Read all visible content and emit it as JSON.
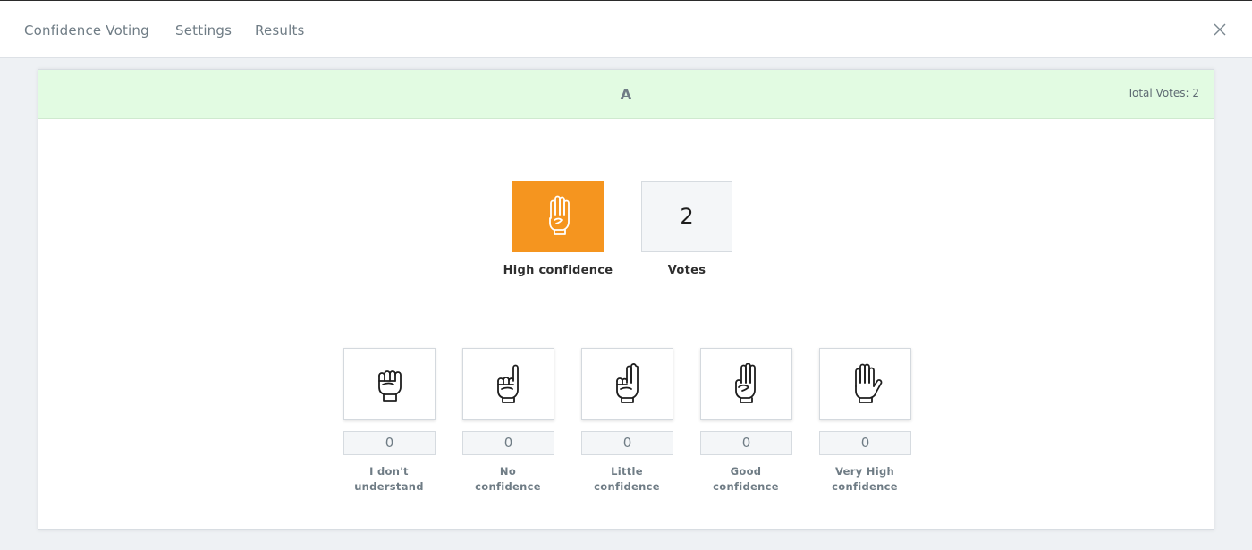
{
  "tabs": [
    {
      "label": "Confidence Voting"
    },
    {
      "label": "Settings"
    },
    {
      "label": "Results"
    }
  ],
  "card": {
    "title": "A",
    "total_votes_label": "Total Votes: 2"
  },
  "summary": {
    "result_label": "High confidence",
    "result_icon": "hand-four-fingers-icon",
    "votes_value": "2",
    "votes_label": "Votes"
  },
  "options": [
    {
      "icon": "fist-icon",
      "count": "0",
      "label_line1": "I don't",
      "label_line2": "understand"
    },
    {
      "icon": "hand-one-finger-icon",
      "count": "0",
      "label_line1": "No",
      "label_line2": "confidence"
    },
    {
      "icon": "hand-two-fingers-icon",
      "count": "0",
      "label_line1": "Little",
      "label_line2": "confidence"
    },
    {
      "icon": "hand-three-fingers-icon",
      "count": "0",
      "label_line1": "Good",
      "label_line2": "confidence"
    },
    {
      "icon": "open-hand-icon",
      "count": "0",
      "label_line1": "Very High",
      "label_line2": "confidence"
    }
  ],
  "colors": {
    "header_bg": "#e2fbe2",
    "selected_bg": "#f5951f",
    "muted_text": "#6f7c85"
  }
}
